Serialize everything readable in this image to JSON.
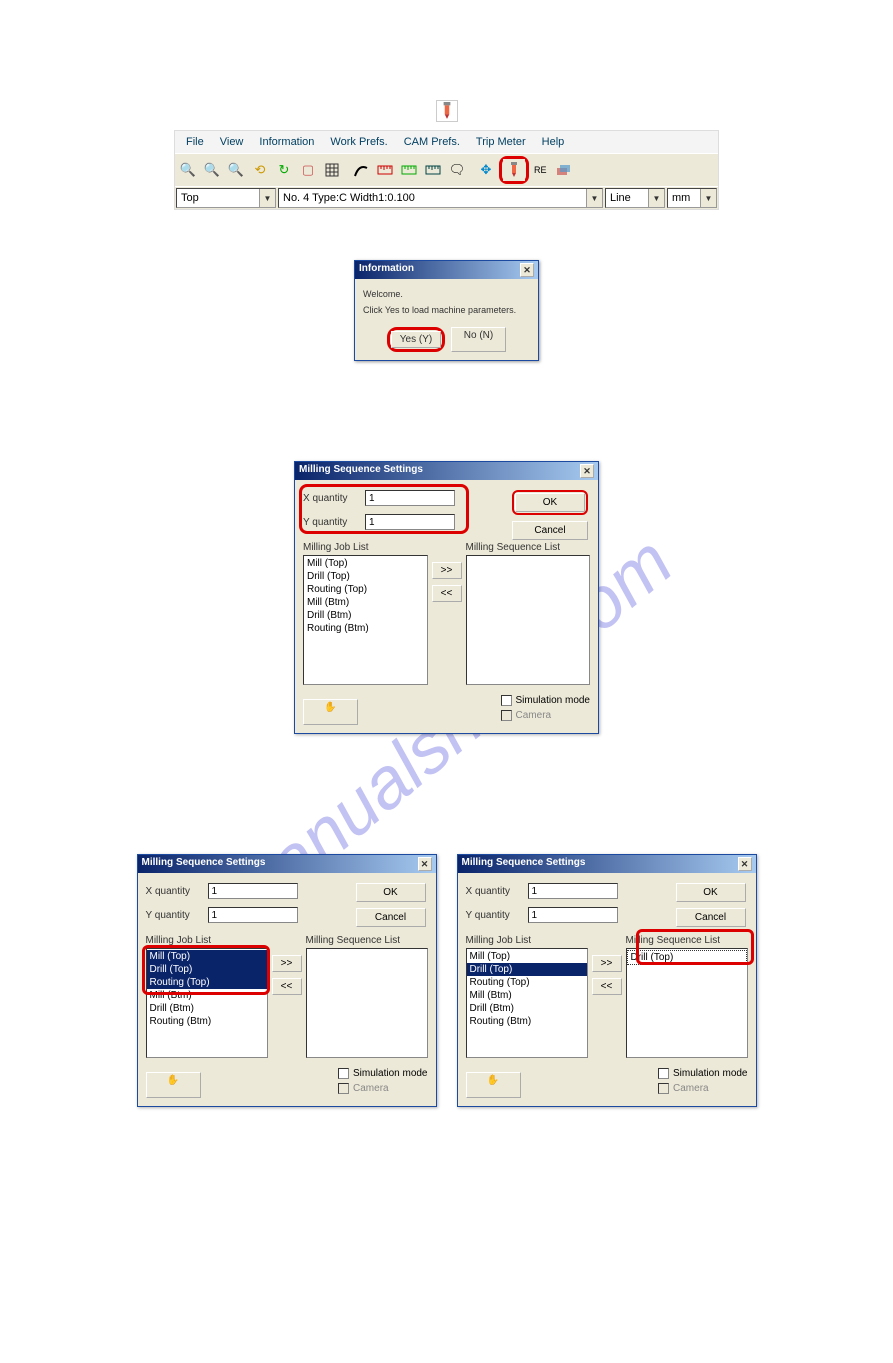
{
  "watermark": "manualshive.com",
  "menubar": {
    "items": [
      "File",
      "View",
      "Information",
      "Work Prefs.",
      "CAM Prefs.",
      "Trip Meter",
      "Help"
    ]
  },
  "toolbar": {
    "icons": [
      "zoom-in",
      "zoom-out",
      "zoom-fit",
      "zoom-prev",
      "refresh",
      "document",
      "grid",
      "sep",
      "curve",
      "ruler-red",
      "ruler-green",
      "ruler-dark",
      "balloon",
      "sep",
      "move-xy",
      "drill-tool",
      "wire",
      "layers"
    ],
    "wire_label": "RE"
  },
  "combos": {
    "layer": "Top",
    "info": "No.   4 Type:C Width1:0.100",
    "style": "Line",
    "unit": "mm"
  },
  "info_dialog": {
    "title": "Information",
    "line1": "Welcome.",
    "line2": "Click Yes to load machine parameters.",
    "yes": "Yes (Y)",
    "no": "No (N)"
  },
  "milling": {
    "title": "Milling Sequence Settings",
    "x_label": "X quantity",
    "y_label": "Y quantity",
    "x_val": "1",
    "y_val": "1",
    "ok": "OK",
    "cancel": "Cancel",
    "job_list_label": "Milling Job List",
    "seq_list_label": "Milling Sequence List",
    "add": ">>",
    "remove": "<<",
    "jobs": [
      "Mill (Top)",
      "Drill (Top)",
      "Routing (Top)",
      "Mill (Btm)",
      "Drill (Btm)",
      "Routing (Btm)"
    ],
    "sim_label": "Simulation mode",
    "camera_label": "Camera"
  },
  "milling_left": {
    "selected_indices": [
      0,
      1,
      2
    ]
  },
  "milling_right": {
    "seq_items": [
      "Drill (Top)"
    ],
    "selected_indices": [
      1
    ]
  }
}
